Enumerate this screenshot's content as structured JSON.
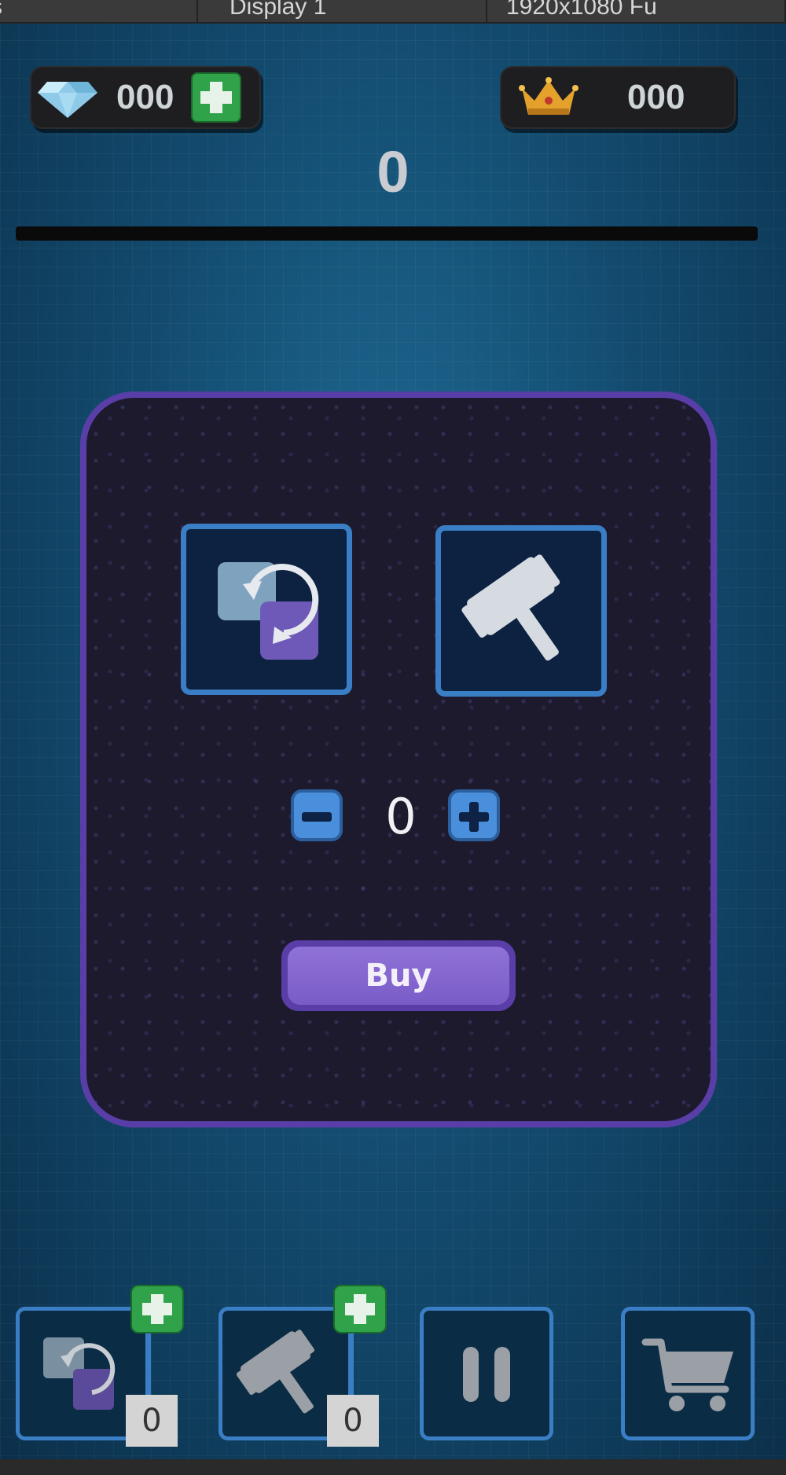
{
  "editor_bar": {
    "col1": "s",
    "col2": "Display 1",
    "col3": "1920x1080 Fu"
  },
  "hud": {
    "gems": {
      "icon": "diamond-icon",
      "value": "000"
    },
    "crowns": {
      "icon": "crown-icon",
      "value": "000"
    },
    "score": "0",
    "progress_fraction": 0
  },
  "shop_panel": {
    "items": [
      {
        "name": "swap",
        "icon": "swap-blocks-icon",
        "selected": true
      },
      {
        "name": "hammer",
        "icon": "hammer-icon",
        "selected": false
      }
    ],
    "quantity": "0",
    "buy_label": "Buy"
  },
  "bottom_bar": {
    "swap_count": "0",
    "hammer_count": "0",
    "pause_icon": "pause-icon",
    "shop_icon": "cart-icon"
  },
  "colors": {
    "accent_purple": "#5a3ea8",
    "slot_border_blue": "#3a7fc6",
    "add_green": "#2fa24a"
  }
}
